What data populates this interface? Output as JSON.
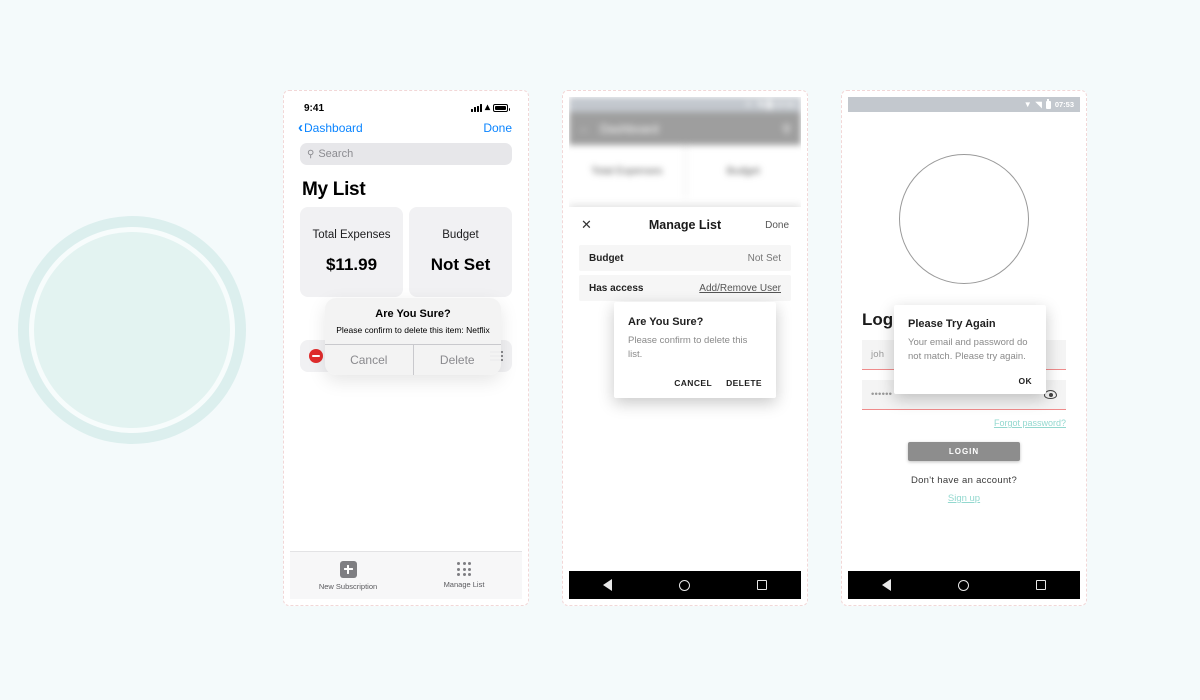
{
  "background": {
    "page_color": "#f4fafb",
    "accent_mint": "#dcefee"
  },
  "decoration": {
    "circle_name": "concentric-mint-circles"
  },
  "ios_phone": {
    "status_bar": {
      "time": "9:41",
      "signal_icon": "signal-bars-icon",
      "wifi_icon": "wifi-icon",
      "battery_icon": "battery-full-icon"
    },
    "nav": {
      "back_icon": "chevron-left-icon",
      "back_label": "Dashboard",
      "done_label": "Done"
    },
    "search": {
      "icon": "search-icon",
      "placeholder": "Search"
    },
    "page_title": "My List",
    "cards": [
      {
        "label": "Total Expenses",
        "value": "$11.99"
      },
      {
        "label": "Budget",
        "value": "Not Set"
      }
    ],
    "list_row": {
      "delete_icon": "minus-circle-delete-icon",
      "reorder_icon": "drag-handle-icon"
    },
    "alert": {
      "title": "Are You Sure?",
      "message": "Please confirm to delete this item: Netflix",
      "cancel_label": "Cancel",
      "delete_label": "Delete"
    },
    "tab_bar": [
      {
        "icon": "plus-square-icon",
        "label": "New Subscription"
      },
      {
        "icon": "grid-dots-icon",
        "label": "Manage List"
      }
    ]
  },
  "android_manage_phone": {
    "status_bar": {
      "time": "07:53",
      "wifi_icon": "wifi-icon",
      "signal_icon": "signal-icon",
      "battery_icon": "battery-icon"
    },
    "toolbar": {
      "back_icon": "back-arrow-icon",
      "title": "Dashboard",
      "search_icon": "search-icon"
    },
    "cards": [
      {
        "label": "Total Expenses"
      },
      {
        "label": "Budget"
      }
    ],
    "sheet": {
      "close_icon": "close-x-icon",
      "title": "Manage List",
      "done_label": "Done",
      "rows": [
        {
          "key": "Budget",
          "value": "Not Set",
          "is_link": false
        },
        {
          "key": "Has access",
          "value": "Add/Remove User",
          "is_link": true
        }
      ]
    },
    "dialog": {
      "title": "Are You Sure?",
      "message": "Please confirm to delete this list.",
      "cancel_label": "CANCEL",
      "confirm_label": "DELETE"
    },
    "nav_bar": {
      "back_icon": "nav-back-triangle-icon",
      "home_icon": "nav-home-circle-icon",
      "recents_icon": "nav-recents-square-icon"
    }
  },
  "android_login_phone": {
    "status_bar": {
      "time": "07:53",
      "wifi_icon": "wifi-icon",
      "signal_icon": "signal-icon",
      "battery_icon": "battery-icon"
    },
    "logo": {
      "icon": "logo-circle-outline"
    },
    "title": "Login",
    "email_field": {
      "value": "joh",
      "error": true
    },
    "password_field": {
      "value": "••••••",
      "reveal_icon": "eye-icon",
      "error": true
    },
    "forgot_link": "Forgot password?",
    "login_button": "LOGIN",
    "no_account_text": "Don't have an account?",
    "signup_link": "Sign up",
    "link_color": "#93d8cf",
    "dialog": {
      "title": "Please Try Again",
      "message": "Your email and password do not match. Please try again.",
      "ok_label": "OK"
    },
    "nav_bar": {
      "back_icon": "nav-back-triangle-icon",
      "home_icon": "nav-home-circle-icon",
      "recents_icon": "nav-recents-square-icon"
    }
  }
}
